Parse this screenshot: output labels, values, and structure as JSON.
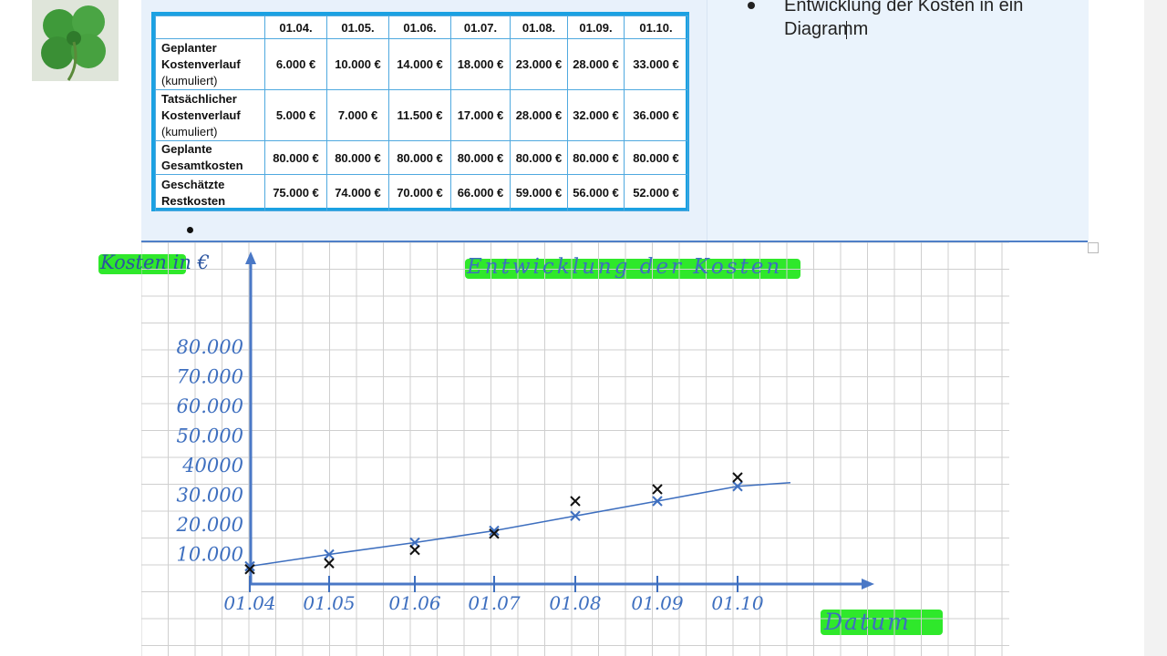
{
  "table": {
    "dates": [
      "01.04.",
      "01.05.",
      "01.06.",
      "01.07.",
      "01.08.",
      "01.09.",
      "01.10."
    ],
    "rows": [
      {
        "label": "Geplanter Kostenverlauf",
        "sub": "(kumuliert)",
        "values": [
          "6.000 €",
          "10.000 €",
          "14.000 €",
          "18.000 €",
          "23.000 €",
          "28.000 €",
          "33.000 €"
        ]
      },
      {
        "label": "Tatsächlicher Kostenverlauf",
        "sub": "(kumuliert)",
        "values": [
          "5.000 €",
          "7.000 €",
          "11.500 €",
          "17.000 €",
          "28.000 €",
          "32.000 €",
          "36.000 €"
        ]
      },
      {
        "label": "Geplante Gesamtkosten",
        "sub": "",
        "values": [
          "80.000 €",
          "80.000 €",
          "80.000 €",
          "80.000 €",
          "80.000 €",
          "80.000 €",
          "80.000 €"
        ]
      },
      {
        "label": "Geschätzte Restkosten",
        "sub": "",
        "values": [
          "75.000 €",
          "74.000 €",
          "70.000 €",
          "66.000 €",
          "59.000 €",
          "56.000 €",
          "52.000 €"
        ]
      }
    ]
  },
  "bullet": {
    "line1": "Entwicklung der Kosten in ein",
    "line2": "Diagramm"
  },
  "chart_data": {
    "type": "line",
    "title": "Entwicklung der Kosten",
    "ylabel": "Kosten in €",
    "xlabel": "Datum",
    "categories": [
      "01.04",
      "01.05",
      "01.06",
      "01.07",
      "01.08",
      "01.09",
      "01.10"
    ],
    "yticks": [
      "10.000",
      "20.000",
      "30.000",
      "40000",
      "50.000",
      "60.000",
      "70.000",
      "80.000"
    ],
    "series": [
      {
        "values": [
          6000,
          10000,
          14000,
          18000,
          23000,
          28000,
          33000
        ],
        "color": "#3e6fbf"
      },
      {
        "values": [
          5000,
          7000,
          11500,
          17000,
          28000,
          32000,
          36000
        ],
        "color": "#111111"
      }
    ],
    "ylim": [
      0,
      80000
    ]
  }
}
